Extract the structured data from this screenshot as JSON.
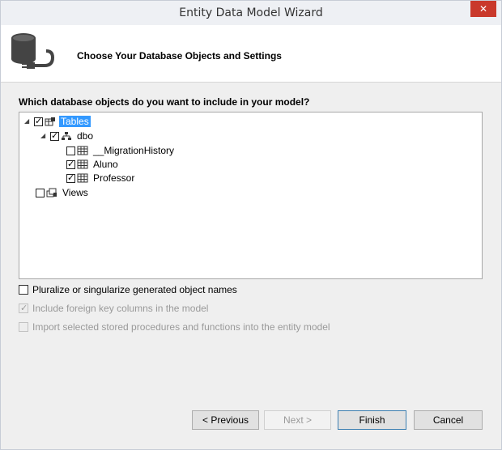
{
  "window": {
    "title": "Entity Data Model Wizard",
    "close_glyph": "✕"
  },
  "header": {
    "title": "Choose Your Database Objects and Settings"
  },
  "question": "Which database objects do you want to include in your model?",
  "tree": {
    "tables_label": "Tables",
    "dbo_label": "dbo",
    "migration_label": "__MigrationHistory",
    "aluno_label": "Aluno",
    "professor_label": "Professor",
    "views_label": "Views"
  },
  "options": {
    "pluralize": "Pluralize or singularize generated object names",
    "foreign_key": "Include foreign key columns in the model",
    "import_procs": "Import selected stored procedures and functions into the entity model"
  },
  "buttons": {
    "previous": "< Previous",
    "next": "Next >",
    "finish": "Finish",
    "cancel": "Cancel"
  },
  "colors": {
    "selection": "#3399ff",
    "close": "#c9392b"
  }
}
